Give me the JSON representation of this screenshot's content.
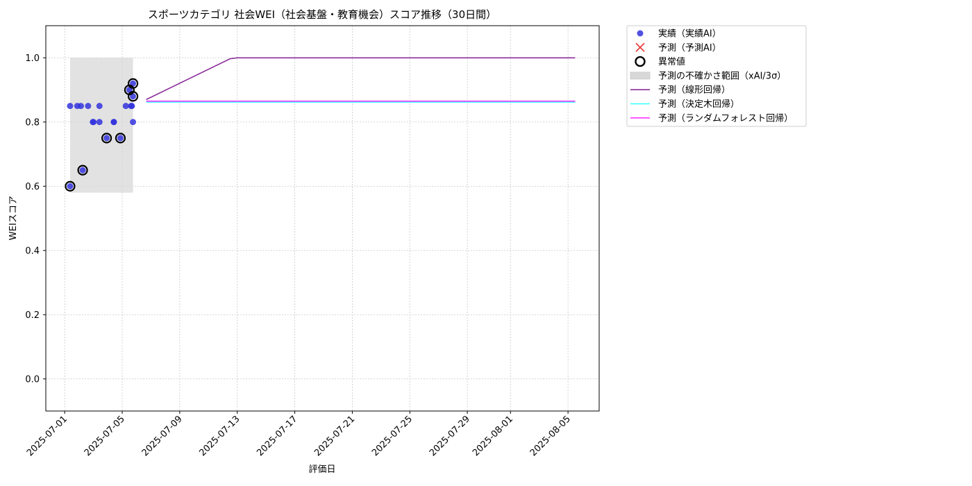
{
  "chart_data": {
    "type": "scatter",
    "title": "スポーツカテゴリ 社会WEI（社会基盤・教育機会）スコア推移（30日間）",
    "xlabel": "評価日",
    "ylabel": "WEIスコア",
    "xlim": [
      "2025-06-29T16:30",
      "2025-08-07T04:00"
    ],
    "ylim": [
      -0.1,
      1.1
    ],
    "y_ticks": [
      "0.0",
      "0.2",
      "0.4",
      "0.6",
      "0.8",
      "1.0"
    ],
    "x_ticks": [
      "2025-07-01",
      "2025-07-05",
      "2025-07-09",
      "2025-07-13",
      "2025-07-17",
      "2025-07-21",
      "2025-07-25",
      "2025-07-29",
      "2025-08-01",
      "2025-08-05"
    ],
    "grid": true,
    "legend_position": "outside-right",
    "legend": [
      "実績（実績AI）",
      "予測（予測AI）",
      "異常値",
      "予測の不確かさ範囲（xAI/3σ）",
      "予測（線形回帰）",
      "予測（決定木回帰）",
      "予測（ランダムフォレスト回帰）"
    ],
    "colors": {
      "actual": "#3333dd",
      "predicted_ai": "#e84040",
      "anomaly": "#000000",
      "uncertainty": "#d8d8d8",
      "linear": "#8b2d9a",
      "tree": "#33ffff",
      "forest": "#ff33ff"
    },
    "actual": [
      {
        "date": "2025-07-01T09:00",
        "value": 0.85
      },
      {
        "date": "2025-07-01T21:00",
        "value": 0.85
      },
      {
        "date": "2025-07-02T03:00",
        "value": 0.85
      },
      {
        "date": "2025-07-02T15:00",
        "value": 0.85
      },
      {
        "date": "2025-07-02T23:00",
        "value": 0.8
      },
      {
        "date": "2025-07-03T00:00",
        "value": 0.8
      },
      {
        "date": "2025-07-03T10:00",
        "value": 0.85
      },
      {
        "date": "2025-07-03T10:00",
        "value": 0.8
      },
      {
        "date": "2025-07-04T10:00",
        "value": 0.8
      },
      {
        "date": "2025-07-04T10:00",
        "value": 0.8
      },
      {
        "date": "2025-07-05T06:00",
        "value": 0.85
      },
      {
        "date": "2025-07-05T15:00",
        "value": 0.85
      },
      {
        "date": "2025-07-05T16:00",
        "value": 0.85
      },
      {
        "date": "2025-07-05T18:00",
        "value": 0.8
      },
      {
        "date": "2025-07-01T09:00",
        "value": 0.6
      },
      {
        "date": "2025-07-02T06:00",
        "value": 0.65
      },
      {
        "date": "2025-07-03T22:00",
        "value": 0.75
      },
      {
        "date": "2025-07-04T21:00",
        "value": 0.75
      },
      {
        "date": "2025-07-05T12:00",
        "value": 0.9
      },
      {
        "date": "2025-07-05T18:00",
        "value": 0.92
      },
      {
        "date": "2025-07-05T18:00",
        "value": 0.88
      }
    ],
    "anomalies": [
      {
        "date": "2025-07-01T09:00",
        "value": 0.6
      },
      {
        "date": "2025-07-02T06:00",
        "value": 0.65
      },
      {
        "date": "2025-07-03T22:00",
        "value": 0.75
      },
      {
        "date": "2025-07-04T21:00",
        "value": 0.75
      },
      {
        "date": "2025-07-05T12:00",
        "value": 0.9
      },
      {
        "date": "2025-07-05T18:00",
        "value": 0.92
      },
      {
        "date": "2025-07-05T18:00",
        "value": 0.88
      }
    ],
    "uncertainty_band": {
      "start": "2025-07-01T09:00",
      "end": "2025-07-05T18:00",
      "low": 0.58,
      "high": 1.0
    },
    "series": [
      {
        "key": "linear",
        "name": "予測（線形回帰）",
        "points": [
          {
            "date": "2025-07-06T16:00",
            "value": 0.87
          },
          {
            "date": "2025-07-12T12:00",
            "value": 0.997
          },
          {
            "date": "2025-07-13T00:00",
            "value": 1.0
          },
          {
            "date": "2025-08-05T12:00",
            "value": 1.0
          }
        ]
      },
      {
        "key": "tree",
        "name": "予測（決定木回帰）",
        "points": [
          {
            "date": "2025-07-06T16:00",
            "value": 0.862
          },
          {
            "date": "2025-08-05T12:00",
            "value": 0.862
          }
        ]
      },
      {
        "key": "forest",
        "name": "予測（ランダムフォレスト回帰）",
        "points": [
          {
            "date": "2025-07-06T16:00",
            "value": 0.865
          },
          {
            "date": "2025-08-05T12:00",
            "value": 0.865
          }
        ]
      }
    ]
  }
}
